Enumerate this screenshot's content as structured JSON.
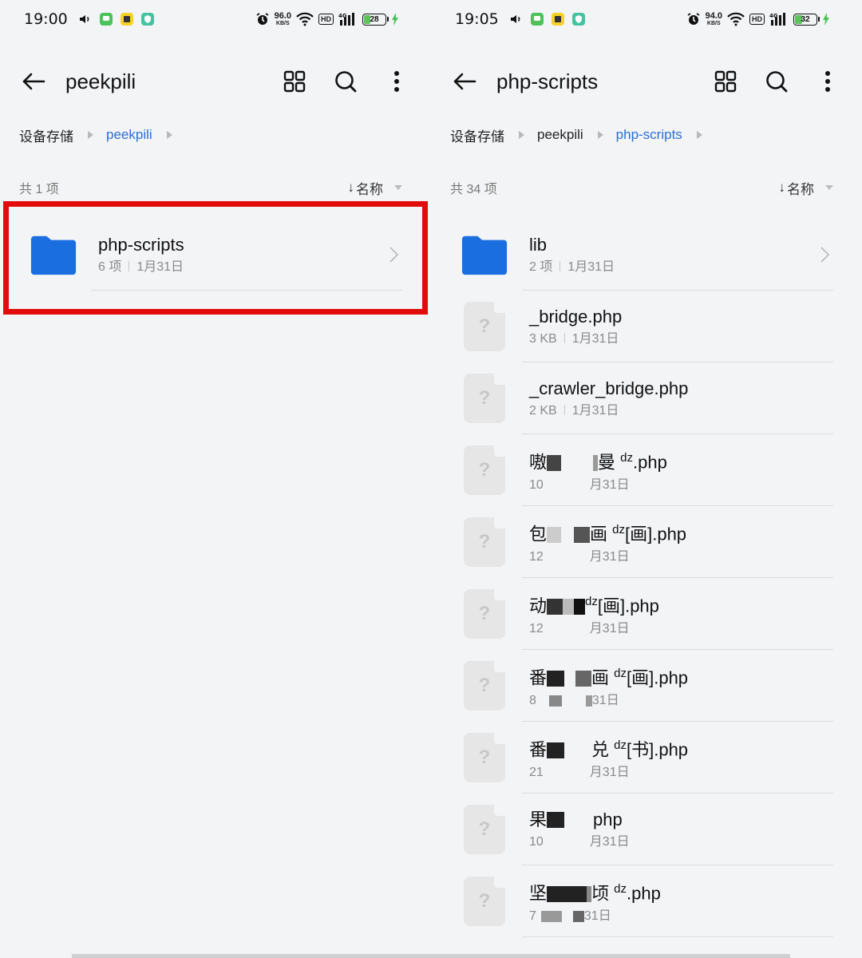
{
  "left": {
    "status": {
      "time": "19:00",
      "speed_value": "96.0",
      "speed_unit": "KB/S",
      "hd": "HD",
      "net": "4G",
      "battery": "28",
      "battery_level": 0.28
    },
    "header": {
      "title": "peekpili"
    },
    "breadcrumb": [
      {
        "label": "设备存储",
        "active": false
      },
      {
        "label": "peekpili",
        "active": true
      }
    ],
    "meta": {
      "count": "共 1 项",
      "sort_label": "名称"
    },
    "items": [
      {
        "name": "php-scripts",
        "count": "6 项",
        "date": "1月31日",
        "type": "folder"
      }
    ]
  },
  "right": {
    "status": {
      "time": "19:05",
      "speed_value": "94.0",
      "speed_unit": "KB/S",
      "hd": "HD",
      "net": "4G",
      "battery": "32",
      "battery_level": 0.32
    },
    "header": {
      "title": "php-scripts"
    },
    "breadcrumb": [
      {
        "label": "设备存储",
        "active": false
      },
      {
        "label": "peekpili",
        "active": false
      },
      {
        "label": "php-scripts",
        "active": true
      }
    ],
    "meta": {
      "count": "共 34 项",
      "sort_label": "名称"
    },
    "items": [
      {
        "name": "lib",
        "size": "2 项",
        "date": "1月31日",
        "type": "folder"
      },
      {
        "name": "_bridge.php",
        "size": "3 KB",
        "date": "1月31日",
        "type": "file"
      },
      {
        "name": "_crawler_bridge.php",
        "size": "2 KB",
        "date": "1月31日",
        "type": "file"
      },
      {
        "name_a": "嗷",
        "name_b": "曼",
        "sup": "dz",
        "name_c": ".php",
        "size": "10",
        "date": "月31日",
        "type": "file-redacted"
      },
      {
        "name_a": "包",
        "name_b": "画",
        "sup": "dz",
        "name_c": "[画].php",
        "size": "12",
        "date": "月31日",
        "type": "file-redacted"
      },
      {
        "name_a": "动",
        "name_b": "",
        "sup": "dz",
        "name_c": "[画].php",
        "size": "12",
        "date": "月31日",
        "type": "file-redacted"
      },
      {
        "name_a": "番",
        "name_b": "画",
        "sup": "dz",
        "name_c": "[画].php",
        "size": "8",
        "date": "31日",
        "type": "file-redacted"
      },
      {
        "name_a": "番",
        "name_b": "兑",
        "sup": "dz",
        "name_c": "[书].php",
        "size": "21",
        "date": "月31日",
        "type": "file-redacted"
      },
      {
        "name_a": "果",
        "name_b": "",
        "sup": "",
        "name_c": "php",
        "size": "10",
        "date": "月31日",
        "type": "file-redacted"
      },
      {
        "name_a": "坚",
        "name_b": "顷",
        "sup": "dz",
        "name_c": ".php",
        "size": "7",
        "date": "31日",
        "type": "file-redacted"
      }
    ]
  },
  "icons": {
    "back": "arrow-left-icon",
    "grid": "grid-view-icon",
    "search": "search-icon",
    "more": "more-vertical-icon",
    "folder": "folder-icon",
    "file": "unknown-file-icon",
    "chevron": "chevron-right-icon"
  },
  "colors": {
    "accent": "#2a6fd6",
    "folder": "#1a6ee0",
    "highlight": "#e30c0c"
  }
}
